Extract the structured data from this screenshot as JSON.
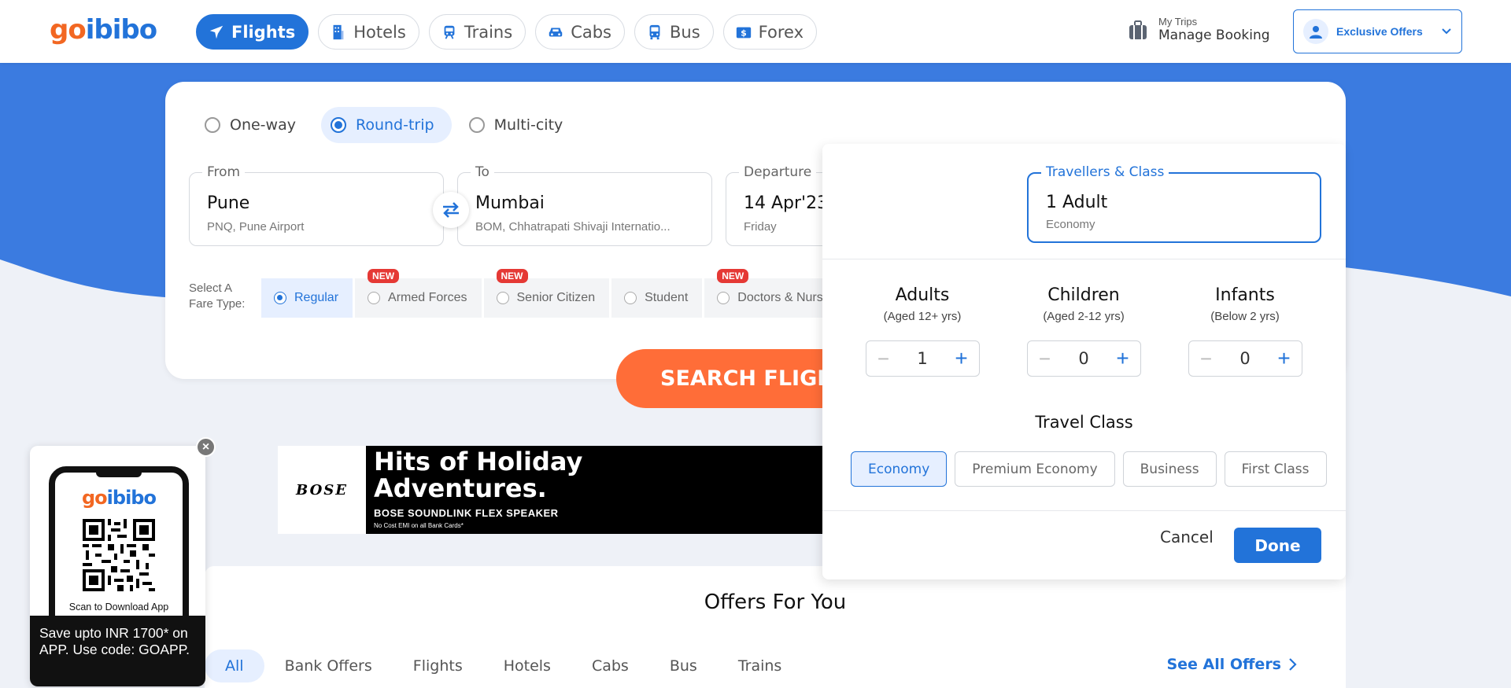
{
  "brand": {
    "go": "go",
    "ibibo": "ibibo"
  },
  "nav": [
    {
      "label": "Flights",
      "icon": "plane-icon",
      "active": true
    },
    {
      "label": "Hotels",
      "icon": "hotel-icon"
    },
    {
      "label": "Trains",
      "icon": "train-icon"
    },
    {
      "label": "Cabs",
      "icon": "car-icon"
    },
    {
      "label": "Bus",
      "icon": "bus-icon"
    },
    {
      "label": "Forex",
      "icon": "currency-icon"
    }
  ],
  "header": {
    "my_trips": "My Trips",
    "manage_booking": "Manage Booking",
    "exclusive_offers": "Exclusive Offers"
  },
  "trip_types": [
    {
      "label": "One-way",
      "selected": false
    },
    {
      "label": "Round-trip",
      "selected": true
    },
    {
      "label": "Multi-city",
      "selected": false
    }
  ],
  "from": {
    "label": "From",
    "city": "Pune",
    "airport": "PNQ, Pune Airport"
  },
  "to": {
    "label": "To",
    "city": "Mumbai",
    "airport": "BOM, Chhatrapati Shivaji Internatio..."
  },
  "departure": {
    "label": "Departure",
    "date": "14 Apr'23",
    "day": "Friday"
  },
  "fare": {
    "label_line1": "Select A",
    "label_line2": "Fare Type:",
    "new_badge": "NEW",
    "options": [
      {
        "label": "Regular",
        "selected": true,
        "is_new": false
      },
      {
        "label": "Armed Forces",
        "selected": false,
        "is_new": true
      },
      {
        "label": "Senior Citizen",
        "selected": false,
        "is_new": true
      },
      {
        "label": "Student",
        "selected": false,
        "is_new": false
      },
      {
        "label": "Doctors & Nurses",
        "selected": false,
        "is_new": true
      }
    ]
  },
  "search_button": "SEARCH FLIGHTS",
  "ad": {
    "brand": "BOSE",
    "headline1": "Hits of Holiday",
    "headline2": "Adventures.",
    "product": "BOSE SOUNDLINK FLEX SPEAKER",
    "emi": "No Cost EMI on all Bank Cards*"
  },
  "travellers": {
    "label": "Travellers & Class",
    "value": "1 Adult",
    "class": "Economy",
    "adults": {
      "title": "Adults",
      "sub": "(Aged 12+ yrs)",
      "count": "1"
    },
    "children": {
      "title": "Children",
      "sub": "(Aged 2-12 yrs)",
      "count": "0"
    },
    "infants": {
      "title": "Infants",
      "sub": "(Below 2 yrs)",
      "count": "0"
    },
    "travel_class_title": "Travel Class",
    "classes": [
      {
        "label": "Economy",
        "selected": true
      },
      {
        "label": "Premium Economy",
        "selected": false
      },
      {
        "label": "Business",
        "selected": false
      },
      {
        "label": "First Class",
        "selected": false
      }
    ],
    "cancel": "Cancel",
    "done": "Done"
  },
  "offers": {
    "title": "Offers For You",
    "tabs": [
      "All",
      "Bank Offers",
      "Flights",
      "Hotels",
      "Cabs",
      "Bus",
      "Trains"
    ],
    "see_all": "See All Offers"
  },
  "app_popup": {
    "scan_text": "Scan to Download App",
    "save_text": "Save upto INR 1700* on APP. Use code: GOAPP."
  },
  "colors": {
    "brand_blue": "#2273d9",
    "brand_orange": "#f26722",
    "search_orange": "#ff6d38"
  }
}
